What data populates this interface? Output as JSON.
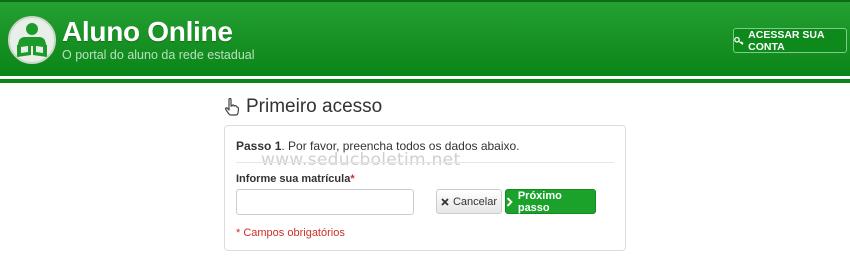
{
  "header": {
    "title": "Aluno Online",
    "subtitle": "O portal do aluno da rede estadual",
    "login_button": "ACESSAR SUA CONTA"
  },
  "page": {
    "title": "Primeiro acesso"
  },
  "form": {
    "step_label": "Passo 1",
    "step_text": ". Por favor, preencha todos os dados abaixo.",
    "watermark": "www.seducboletim.net",
    "field_label": "Informe sua matrícula",
    "required_mark": "*",
    "input_value": "",
    "cancel_label": "Cancelar",
    "next_label": "Próximo passo",
    "required_note": "* Campos obrigatórios"
  },
  "colors": {
    "brand_green": "#0b8418",
    "button_green": "#1aa22b",
    "required_red": "#c9302c"
  },
  "icons": {
    "logo": "students-logo-icon",
    "login": "key-icon",
    "heading": "pointing-hand-icon",
    "cancel": "close-icon",
    "next": "chevron-right-icon"
  }
}
